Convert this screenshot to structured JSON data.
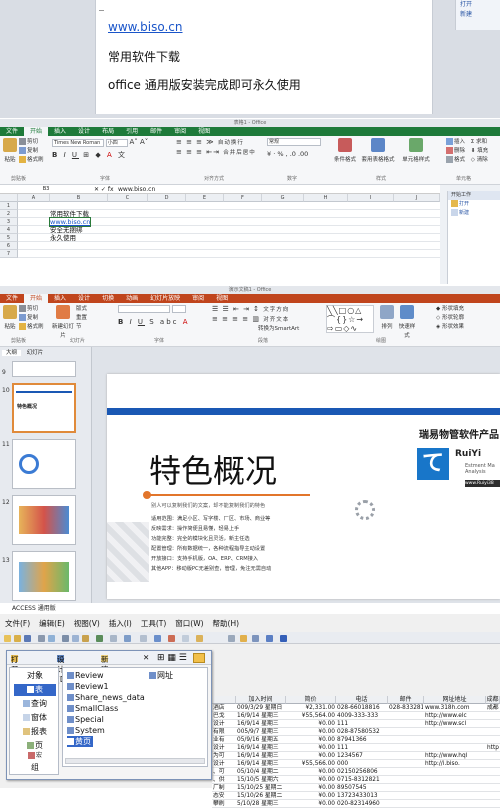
{
  "word": {
    "lines": [
      "www.biso.cn",
      "常用软件下载",
      "office 通用版安装完成即可永久使用"
    ],
    "right_pane": [
      "打开",
      "新建"
    ]
  },
  "excel": {
    "title": "表格1 - Office",
    "tabs": [
      "文件",
      "开始",
      "插入",
      "设计",
      "布局",
      "引用",
      "邮件",
      "审阅",
      "视图"
    ],
    "active_tab": "开始",
    "ribbon": {
      "paste": "粘贴",
      "cut": "剪切",
      "copy": "复制",
      "format_painter": "格式刷",
      "font_name": "Times New Roman",
      "font_size": "小四",
      "wrap": "自动换行",
      "merge": "合并后居中",
      "number_format": "常规",
      "conditional": "条件格式",
      "table_format": "套用表格格式",
      "cell_style": "单元格样式",
      "insert": "插入",
      "delete": "删除",
      "format": "格式",
      "sum": "求和",
      "fill": "填充",
      "clear": "清除",
      "groups": [
        "剪贴板",
        "字体",
        "对齐方式",
        "数字",
        "样式",
        "单元格"
      ]
    },
    "name_box": "B3",
    "formula": "www.biso.cn",
    "columns": [
      "A",
      "B",
      "C",
      "D",
      "E",
      "F",
      "G",
      "H",
      "I",
      "J"
    ],
    "rows": [
      "1",
      "2",
      "3",
      "4",
      "5",
      "6",
      "7"
    ],
    "cells": [
      "常用软件下载",
      "www.biso.cn",
      "安全无捆绑",
      "永久使用"
    ],
    "side_panel": {
      "title": "开始工作",
      "items": [
        "打开",
        "新建"
      ]
    }
  },
  "ppt": {
    "title": "演示文稿1 - Office",
    "tabs": [
      "文件",
      "开始",
      "插入",
      "设计",
      "切换",
      "动画",
      "幻灯片放映",
      "审阅",
      "视图"
    ],
    "active_tab": "开始",
    "ribbon": {
      "paste": "粘贴",
      "cut": "剪切",
      "copy": "复制",
      "format_painter": "格式刷",
      "new_slide": "新建幻灯片",
      "layout": "版式",
      "reset": "重置",
      "section": "节",
      "text_direction": "文字方向",
      "align_text": "对齐文本",
      "convert_smartart": "转换为SmartArt",
      "arrange": "排列",
      "quick_styles": "快速样式",
      "shape_fill": "形状填充",
      "shape_outline": "形状轮廓",
      "shape_effects": "形状效果",
      "find": "查找",
      "replace": "替换",
      "select": "选择",
      "groups": [
        "剪贴板",
        "幻灯片",
        "字体",
        "段落",
        "绘图",
        "编辑"
      ]
    },
    "panel_tabs": [
      "大纲",
      "幻灯片"
    ],
    "slide_numbers": [
      "9",
      "10",
      "11",
      "12",
      "13"
    ],
    "slide": {
      "brand_title": "瑞易物管软件产品",
      "brand_logo_text": "RuiYi",
      "brand_sub": [
        "Estment Ma",
        "Analysis",
        "www.Ruiyi38"
      ],
      "heading": "特色概况",
      "subtitle": "别人可以复制我们的文案，却不能复制我们的特色",
      "features": [
        "适用范围：满足小区、写字楼、厂区、市场、商业等",
        "反映需求：操作简便且易懂，轻易上手",
        "功能完整：完全的模块化且灵活，新主任选",
        "配置管理：所有数据统一，各种流程指导主动设置",
        "开放接口：支持手机版，OA、ERP、CRM接入",
        "其他APP：移动版PC无差别查，管理，免注无需自动"
      ]
    }
  },
  "access": {
    "title": "ACCESS 通用版",
    "menu": [
      "文件(F)",
      "编辑(E)",
      "视图(V)",
      "插入(I)",
      "工具(T)",
      "窗口(W)",
      "帮助(H)"
    ],
    "db_toolbar": {
      "open": "打开(O)",
      "design": "设计(D)",
      "new": "新建(N)",
      "delete": "✕"
    },
    "objects_header": "对象",
    "objects": [
      "表",
      "查询",
      "窗体",
      "报表",
      "页",
      "宏",
      "组"
    ],
    "selected_object": "表",
    "tables": [
      "Review",
      "Review1",
      "Share_news_data",
      "SmallClass",
      "Special",
      "System",
      "黄页"
    ],
    "selected_table": "黄页",
    "tables_col2": [
      "网址"
    ],
    "grid_headers": [
      "",
      "加入时间",
      "简价",
      "电话",
      "邮件",
      "网址地址",
      "成都"
    ],
    "grid_rows": [
      [
        "酒店",
        "009/3/29 星期日",
        "¥2,331.00",
        "028-66018816",
        "028-83328167",
        "www.318h.com",
        "成都"
      ],
      [
        "巴戈",
        "16/9/14 星期三",
        "¥55,564.00",
        "4009-333-333",
        "",
        "http://www.elc",
        ""
      ],
      [
        "设计",
        "16/9/14 星期三",
        "¥0.00",
        "111",
        "",
        "http://www.scl",
        ""
      ],
      [
        "有限",
        "005/9/7 星期三",
        "¥0.00",
        "028-87580532",
        "",
        "",
        ""
      ],
      [
        "业有",
        "05/9/16 星期五",
        "¥0.00",
        "87941366",
        "",
        "",
        ""
      ],
      [
        "设计",
        "16/9/14 星期三",
        "¥0.00",
        "111",
        "",
        "",
        "http"
      ],
      [
        "为可",
        "16/9/14 星期三",
        "¥0.00",
        "1234567",
        "",
        "http://www.hql",
        ""
      ],
      [
        "设计",
        "16/9/14 星期三",
        "¥55,566.00",
        "000",
        "",
        "http://i.biso.",
        ""
      ],
      [
        "、可",
        "05/10/4 星期二",
        "¥0.00",
        "02150256806",
        "",
        "",
        ""
      ],
      [
        "、供",
        "15/10/5 星期六",
        "¥0.00",
        "0715-8312821",
        "",
        "",
        ""
      ],
      [
        "厂制",
        "15/10/25 星期二",
        "¥0.00",
        "89507545",
        "",
        "",
        ""
      ],
      [
        "态安",
        "15/10/26 星期二",
        "¥0.00",
        "13723433013",
        "",
        "",
        ""
      ],
      [
        "攀刷",
        "5/10/28 星期三",
        "¥0.00",
        "020-82314960",
        "",
        "",
        ""
      ]
    ]
  }
}
